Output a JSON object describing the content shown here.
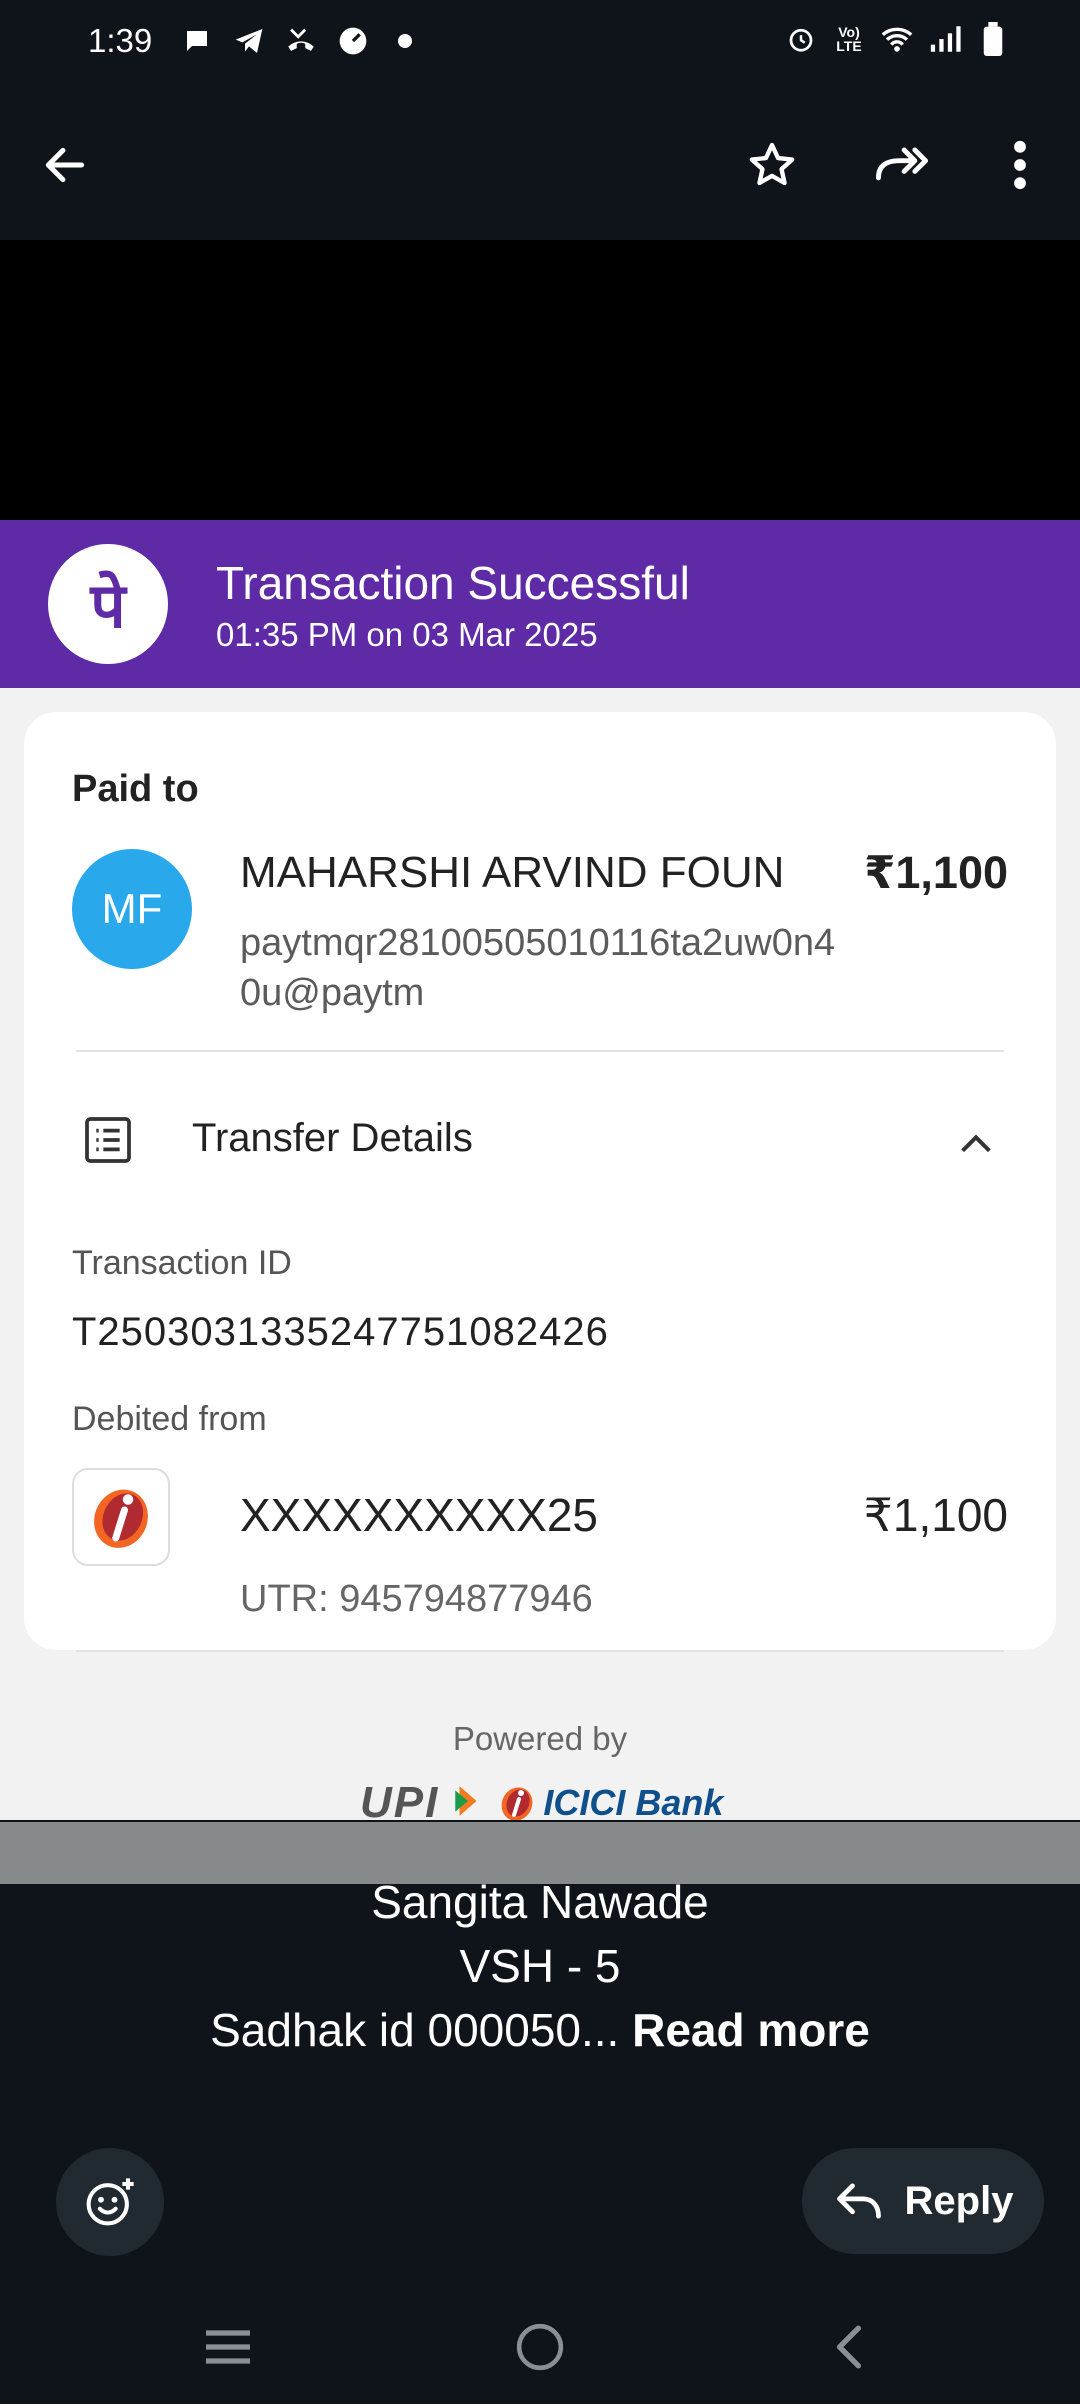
{
  "status_bar": {
    "time": "1:39",
    "network": "Vo) LTE",
    "left_icons": [
      "chat-bubble-icon",
      "telegram-icon",
      "missed-call-icon",
      "speedometer-icon",
      "dot-icon"
    ],
    "right_icons": [
      "alarm-icon",
      "volte-icon",
      "wifi-icon",
      "signal-icon",
      "battery-icon"
    ]
  },
  "top_bar": {
    "back_icon": "arrow-left-icon",
    "actions": [
      "star-icon",
      "forward-all-icon",
      "more-vert-icon"
    ]
  },
  "receipt": {
    "brand_glyph": "पे",
    "status_title": "Transaction Successful",
    "status_time": "01:35 PM on 03 Mar 2025",
    "paid_to_label": "Paid to",
    "avatar_initials": "MF",
    "merchant_name": "MAHARSHI ARVIND FOUN",
    "amount": "₹1,100",
    "upi_id": "paytmqr28100505010116ta2uw0n40u@paytm",
    "transfer_details_label": "Transfer Details",
    "transaction_id_label": "Transaction ID",
    "transaction_id": "T2503031335247751082426",
    "debited_from_label": "Debited from",
    "account_number": "XXXXXXXXXX25",
    "debit_amount": "₹1,100",
    "utr": "UTR: 945794877946",
    "powered_by": "Powered by",
    "upi_logo_text": "UPI",
    "bank_logo_text": "ICICI Bank"
  },
  "caption": {
    "line1": "Sangita Nawade",
    "line2": "VSH - 5",
    "line3": "Sadhak id 000050...",
    "read_more": "Read more"
  },
  "bottom_actions": {
    "reply_label": "Reply"
  },
  "nav_bar": {
    "buttons": [
      "recents-icon",
      "home-icon",
      "back-icon"
    ]
  },
  "colors": {
    "phonepe_purple": "#5f2aa6",
    "avatar_blue": "#2aa8ec",
    "background_dark": "#0f141a"
  }
}
